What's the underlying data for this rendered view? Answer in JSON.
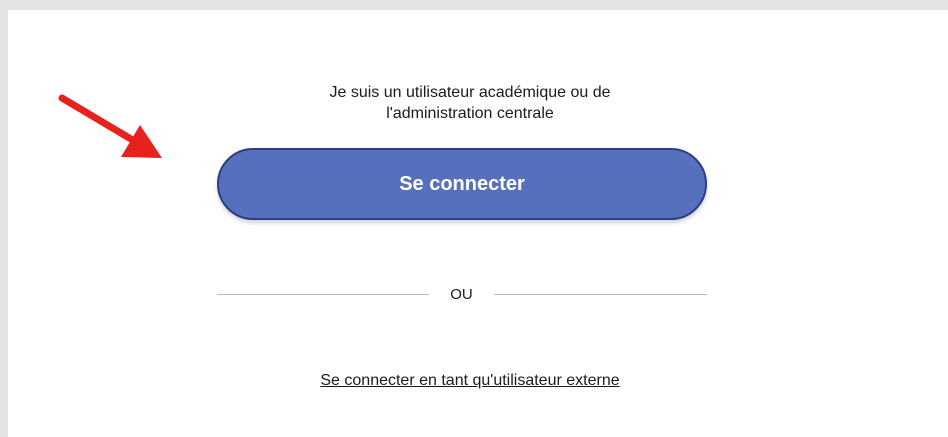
{
  "intro": {
    "line1": "Je suis un utilisateur académique ou de",
    "line2": "l'administration centrale"
  },
  "login_button": {
    "label": "Se connecter",
    "color": "#5770be"
  },
  "separator": {
    "label": "OU"
  },
  "external_link": {
    "label": "Se connecter en tant qu'utilisateur externe"
  },
  "annotation": {
    "icon": "arrow-icon",
    "color": "#e8211c"
  }
}
